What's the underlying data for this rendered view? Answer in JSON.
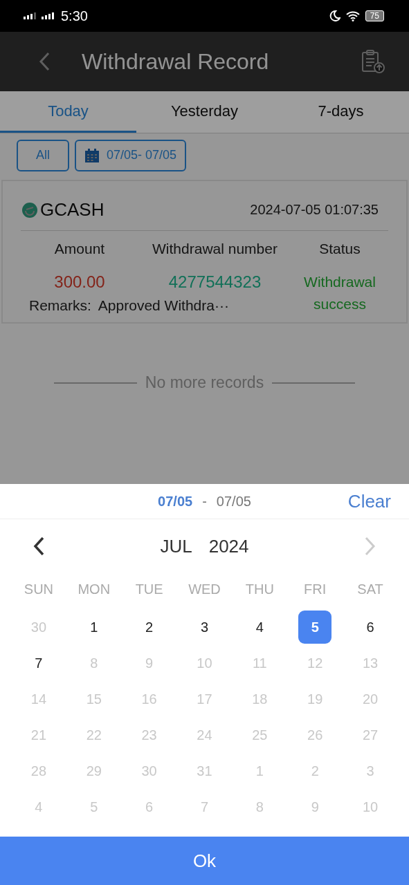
{
  "status_bar": {
    "time": "5:30",
    "battery": "75"
  },
  "header": {
    "title": "Withdrawal Record"
  },
  "tabs": [
    {
      "label": "Today",
      "selected": true
    },
    {
      "label": "Yesterday",
      "selected": false
    },
    {
      "label": "7-days",
      "selected": false
    }
  ],
  "filters": {
    "all": "All",
    "date_range": "07/05- 07/05"
  },
  "records": [
    {
      "method": "GCASH",
      "time": "2024-07-05 01:07:35",
      "columns": [
        "Amount",
        "Withdrawal number",
        "Status"
      ],
      "amount": "300.00",
      "number": "4277544323",
      "status": [
        "Withdrawal",
        "success"
      ],
      "remarks_label": "Remarks:",
      "remarks": "Approved Withdra···"
    }
  ],
  "end_text": "No more records",
  "picker": {
    "start": "07/05",
    "separator": "-",
    "end": "07/05",
    "clear": "Clear",
    "month": "JUL",
    "year": "2024",
    "weekdays": [
      "SUN",
      "MON",
      "TUE",
      "WED",
      "THU",
      "FRI",
      "SAT"
    ],
    "days": [
      {
        "label": "30",
        "disabled": true,
        "selected": false
      },
      {
        "label": "1",
        "disabled": false,
        "selected": false
      },
      {
        "label": "2",
        "disabled": false,
        "selected": false
      },
      {
        "label": "3",
        "disabled": false,
        "selected": false
      },
      {
        "label": "4",
        "disabled": false,
        "selected": false
      },
      {
        "label": "5",
        "disabled": false,
        "selected": true
      },
      {
        "label": "6",
        "disabled": false,
        "selected": false
      },
      {
        "label": "7",
        "disabled": false,
        "selected": false
      },
      {
        "label": "8",
        "disabled": true,
        "selected": false
      },
      {
        "label": "9",
        "disabled": true,
        "selected": false
      },
      {
        "label": "10",
        "disabled": true,
        "selected": false
      },
      {
        "label": "11",
        "disabled": true,
        "selected": false
      },
      {
        "label": "12",
        "disabled": true,
        "selected": false
      },
      {
        "label": "13",
        "disabled": true,
        "selected": false
      },
      {
        "label": "14",
        "disabled": true,
        "selected": false
      },
      {
        "label": "15",
        "disabled": true,
        "selected": false
      },
      {
        "label": "16",
        "disabled": true,
        "selected": false
      },
      {
        "label": "17",
        "disabled": true,
        "selected": false
      },
      {
        "label": "18",
        "disabled": true,
        "selected": false
      },
      {
        "label": "19",
        "disabled": true,
        "selected": false
      },
      {
        "label": "20",
        "disabled": true,
        "selected": false
      },
      {
        "label": "21",
        "disabled": true,
        "selected": false
      },
      {
        "label": "22",
        "disabled": true,
        "selected": false
      },
      {
        "label": "23",
        "disabled": true,
        "selected": false
      },
      {
        "label": "24",
        "disabled": true,
        "selected": false
      },
      {
        "label": "25",
        "disabled": true,
        "selected": false
      },
      {
        "label": "26",
        "disabled": true,
        "selected": false
      },
      {
        "label": "27",
        "disabled": true,
        "selected": false
      },
      {
        "label": "28",
        "disabled": true,
        "selected": false
      },
      {
        "label": "29",
        "disabled": true,
        "selected": false
      },
      {
        "label": "30",
        "disabled": true,
        "selected": false
      },
      {
        "label": "31",
        "disabled": true,
        "selected": false
      },
      {
        "label": "1",
        "disabled": true,
        "selected": false
      },
      {
        "label": "2",
        "disabled": true,
        "selected": false
      },
      {
        "label": "3",
        "disabled": true,
        "selected": false
      },
      {
        "label": "4",
        "disabled": true,
        "selected": false
      },
      {
        "label": "5",
        "disabled": true,
        "selected": false
      },
      {
        "label": "6",
        "disabled": true,
        "selected": false
      },
      {
        "label": "7",
        "disabled": true,
        "selected": false
      },
      {
        "label": "8",
        "disabled": true,
        "selected": false
      },
      {
        "label": "9",
        "disabled": true,
        "selected": false
      },
      {
        "label": "10",
        "disabled": true,
        "selected": false
      }
    ],
    "ok": "Ok"
  }
}
